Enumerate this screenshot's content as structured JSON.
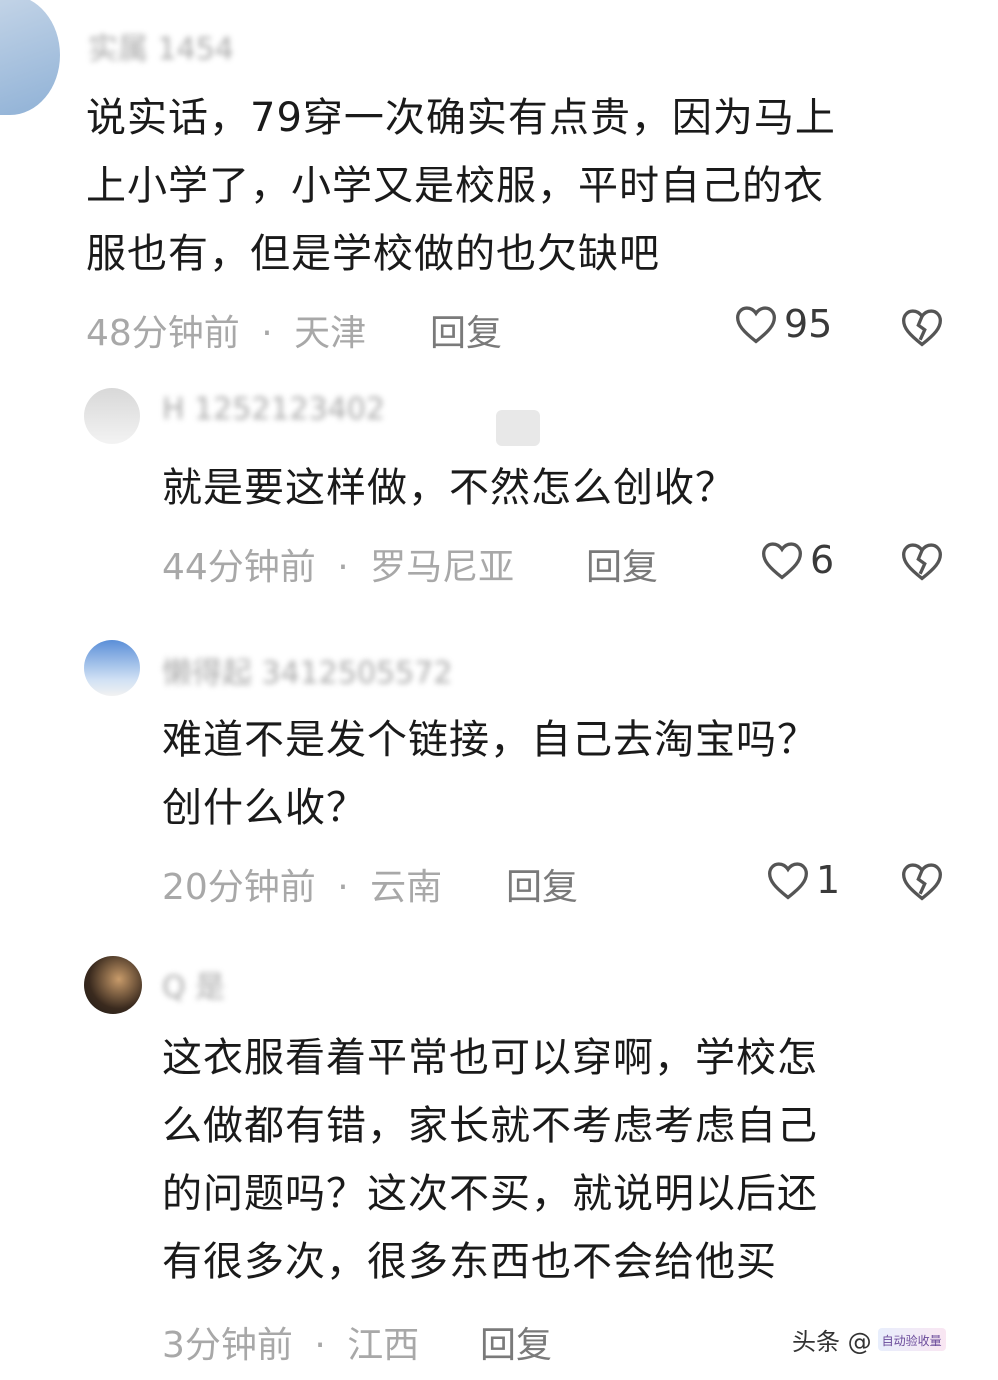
{
  "comments": [
    {
      "username": "实属 1454",
      "text_lines": [
        "说实话，79穿一次确实有点贵，因为马上",
        "上小学了，小学又是校服，平时自己的衣",
        "服也有，但是学校做的也欠缺吧"
      ],
      "time": "48分钟前",
      "location": "天津",
      "reply_label": "回复",
      "likes": "95"
    },
    {
      "username": "H 1252123402",
      "text_lines": [
        "就是要这样做，不然怎么创收？"
      ],
      "time": "44分钟前",
      "location": "罗马尼亚",
      "reply_label": "回复",
      "likes": "6"
    },
    {
      "username": "懒得起 3412505572",
      "text_lines": [
        "难道不是发个链接，自己去淘宝吗？",
        "创什么收？"
      ],
      "time": "20分钟前",
      "location": "云南",
      "reply_label": "回复",
      "likes": "1"
    },
    {
      "username": "Q 是",
      "text_lines": [
        "这衣服看着平常也可以穿啊，学校怎",
        "么做都有错，家长就不考虑考虑自己",
        "的问题吗？这次不买，就说明以后还",
        "有很多次，很多东西也不会给他买"
      ],
      "time": "3分钟前",
      "location": "江西",
      "reply_label": "回复"
    }
  ],
  "separator": "·",
  "watermark": {
    "text": "头条 @",
    "badge_text": "自动验收量"
  },
  "colors": {
    "meta": "#a8a8a8",
    "icon": "#555555",
    "body_text": "#1a1a1a"
  },
  "icons": [
    "heart-outline-icon",
    "broken-heart-icon"
  ]
}
